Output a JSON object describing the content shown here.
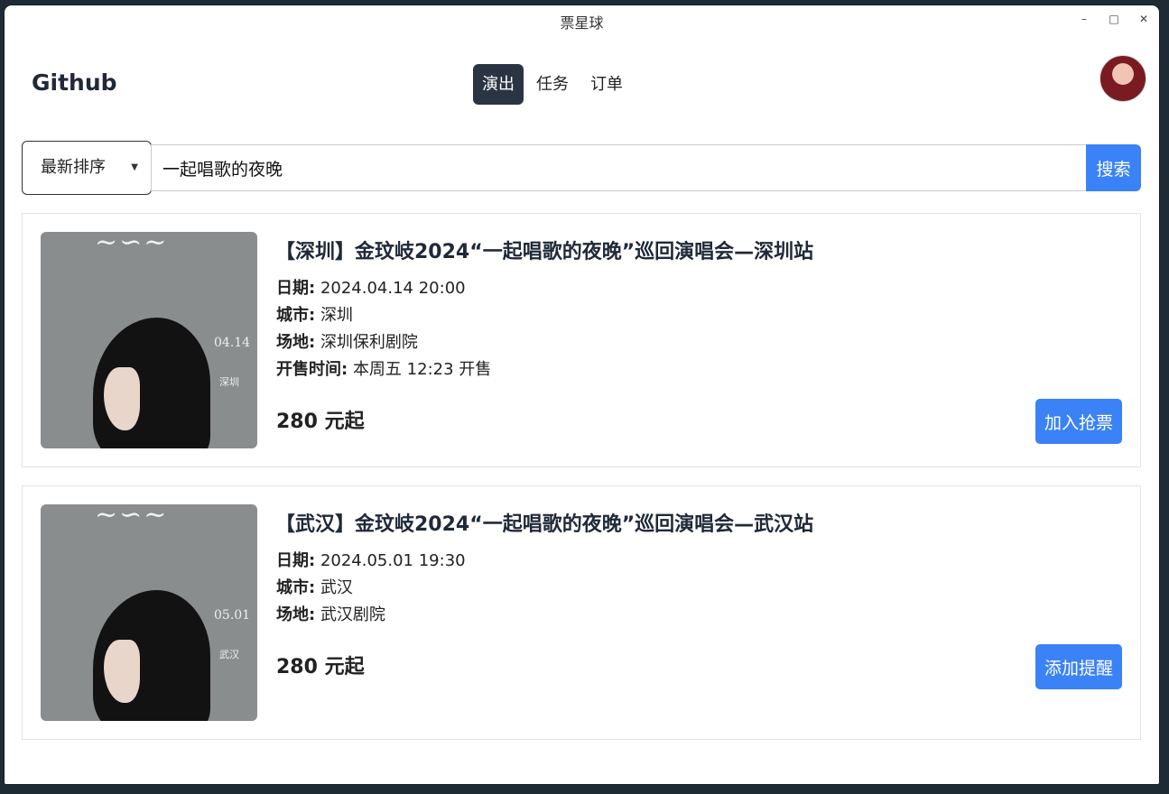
{
  "window": {
    "title": "票星球"
  },
  "nav": {
    "brand": "Github",
    "tabs": [
      "演出",
      "任务",
      "订单"
    ]
  },
  "search": {
    "sort_label": "最新排序",
    "query": "一起唱歌的夜晚",
    "button": "搜索"
  },
  "events": [
    {
      "title": "【深圳】金玟岐2024“一起唱歌的夜晚”巡回演唱会—深圳站",
      "date_label": "日期:",
      "date": "2024.04.14 20:00",
      "city_label": "城市:",
      "city": "深圳",
      "venue_label": "场地:",
      "venue": "深圳保利剧院",
      "sale_label": "开售时间:",
      "sale": "本周五 12:23 开售",
      "price": "280 元起",
      "action": "加入抢票",
      "poster_date": "04.14",
      "poster_city": "深圳"
    },
    {
      "title": "【武汉】金玟岐2024“一起唱歌的夜晚”巡回演唱会—武汉站",
      "date_label": "日期:",
      "date": "2024.05.01 19:30",
      "city_label": "城市:",
      "city": "武汉",
      "venue_label": "场地:",
      "venue": "武汉剧院",
      "price": "280 元起",
      "action": "添加提醒",
      "poster_date": "05.01",
      "poster_city": "武汉"
    }
  ],
  "colors": {
    "accent": "#3b82f6",
    "active_tab": "#2a3442"
  }
}
